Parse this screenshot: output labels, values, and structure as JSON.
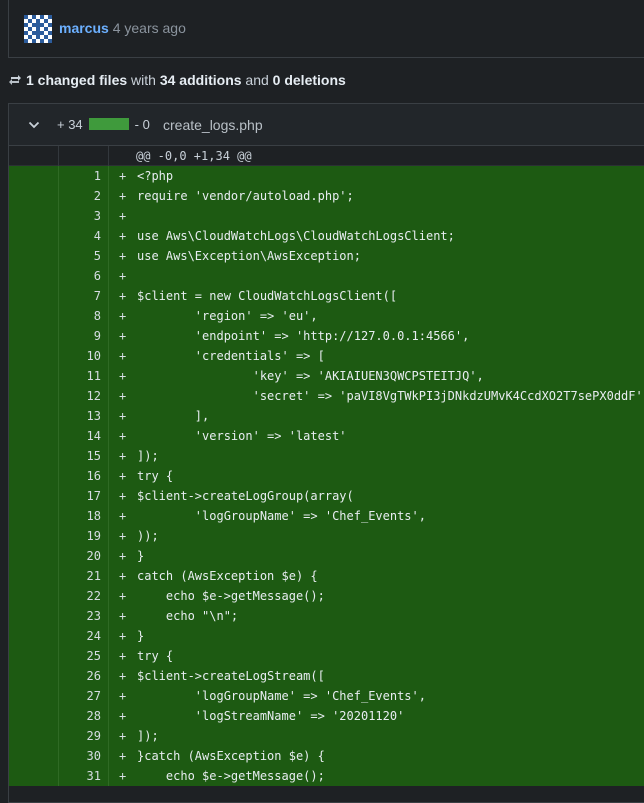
{
  "commit": {
    "author": "marcus",
    "time_ago": "4 years ago"
  },
  "summary": {
    "changed_files": "1 changed files",
    "with": "with",
    "additions": "34 additions",
    "and": "and",
    "deletions": "0 deletions"
  },
  "file": {
    "additions": "+ 34",
    "deletions": "- 0",
    "name": "create_logs.php",
    "hunk_header": "@@ -0,0 +1,34 @@",
    "diffbar_color": "#3f9a3c",
    "added_line_bg": "#1d5a12"
  },
  "lines": [
    {
      "num": "1",
      "marker": "+",
      "code": "<?php"
    },
    {
      "num": "2",
      "marker": "+",
      "code": "require 'vendor/autoload.php';"
    },
    {
      "num": "3",
      "marker": "+",
      "code": ""
    },
    {
      "num": "4",
      "marker": "+",
      "code": "use Aws\\CloudWatchLogs\\CloudWatchLogsClient;"
    },
    {
      "num": "5",
      "marker": "+",
      "code": "use Aws\\Exception\\AwsException;"
    },
    {
      "num": "6",
      "marker": "+",
      "code": ""
    },
    {
      "num": "7",
      "marker": "+",
      "code": "$client = new CloudWatchLogsClient(["
    },
    {
      "num": "8",
      "marker": "+",
      "code": "        'region' => 'eu',"
    },
    {
      "num": "9",
      "marker": "+",
      "code": "        'endpoint' => 'http://127.0.0.1:4566',"
    },
    {
      "num": "10",
      "marker": "+",
      "code": "        'credentials' => ["
    },
    {
      "num": "11",
      "marker": "+",
      "code": "                'key' => 'AKIAIUEN3QWCPSTEITJQ',"
    },
    {
      "num": "12",
      "marker": "+",
      "code": "                'secret' => 'paVI8VgTWkPI3jDNkdzUMvK4CcdXO2T7sePX0ddF'"
    },
    {
      "num": "13",
      "marker": "+",
      "code": "        ],"
    },
    {
      "num": "14",
      "marker": "+",
      "code": "        'version' => 'latest'"
    },
    {
      "num": "15",
      "marker": "+",
      "code": "]);"
    },
    {
      "num": "16",
      "marker": "+",
      "code": "try {"
    },
    {
      "num": "17",
      "marker": "+",
      "code": "$client->createLogGroup(array("
    },
    {
      "num": "18",
      "marker": "+",
      "code": "        'logGroupName' => 'Chef_Events',"
    },
    {
      "num": "19",
      "marker": "+",
      "code": "));"
    },
    {
      "num": "20",
      "marker": "+",
      "code": "}"
    },
    {
      "num": "21",
      "marker": "+",
      "code": "catch (AwsException $e) {"
    },
    {
      "num": "22",
      "marker": "+",
      "code": "    echo $e->getMessage();"
    },
    {
      "num": "23",
      "marker": "+",
      "code": "    echo \"\\n\";"
    },
    {
      "num": "24",
      "marker": "+",
      "code": "}"
    },
    {
      "num": "25",
      "marker": "+",
      "code": "try {"
    },
    {
      "num": "26",
      "marker": "+",
      "code": "$client->createLogStream(["
    },
    {
      "num": "27",
      "marker": "+",
      "code": "        'logGroupName' => 'Chef_Events',"
    },
    {
      "num": "28",
      "marker": "+",
      "code": "        'logStreamName' => '20201120'"
    },
    {
      "num": "29",
      "marker": "+",
      "code": "]);"
    },
    {
      "num": "30",
      "marker": "+",
      "code": "}catch (AwsException $e) {"
    },
    {
      "num": "31",
      "marker": "+",
      "code": "    echo $e->getMessage();"
    }
  ],
  "icons": {
    "avatar": "identicon-avatar",
    "summary": "commit-compare-icon",
    "toggle": "chevron-down-icon"
  }
}
